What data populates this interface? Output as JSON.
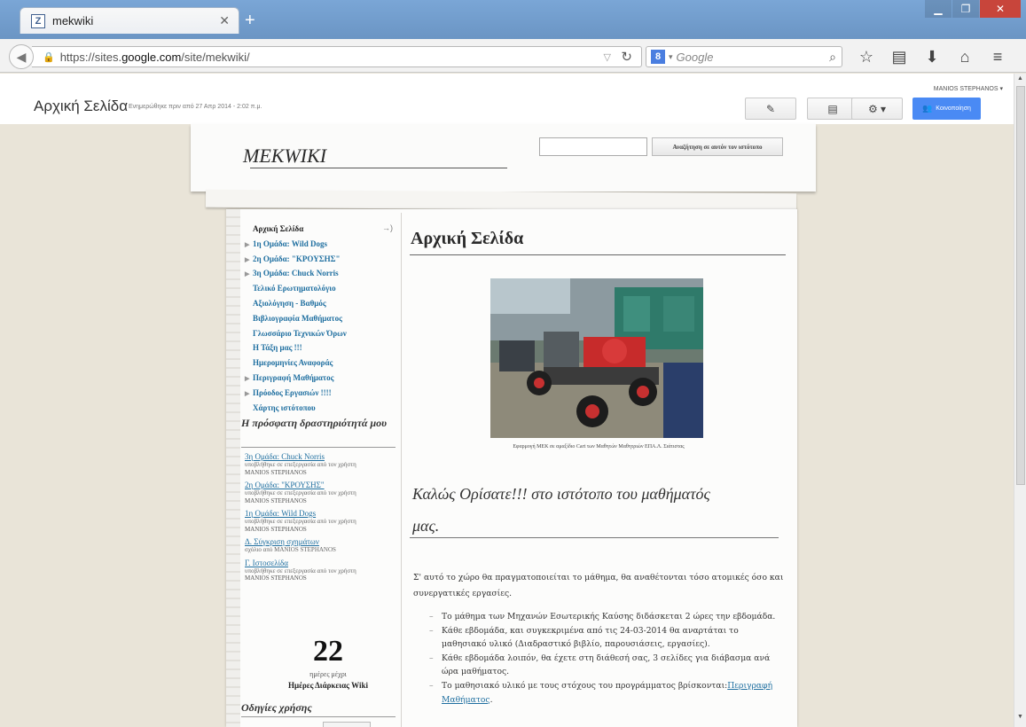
{
  "browser": {
    "tab_title": "mekwiki",
    "tab_favicon": "Z",
    "url_prefix": "https://sites.",
    "url_host": "google.com",
    "url_path": "/site/mekwiki/",
    "search_placeholder": "Google",
    "search_engine_letter": "8"
  },
  "sites_header": {
    "page_title": "Αρχική Σελίδα",
    "updated": "Ενημερώθηκε πριν από 27 Απρ 2014 - 2:02 π.μ.",
    "username": "MANIOS STEPHANOS",
    "share_label": "Κοινοποίηση",
    "accent_color": "#4a8af4"
  },
  "site": {
    "title": "MEKWIKI",
    "search_button": "Αναζήτηση σε αυτόν τον ιστότοπο"
  },
  "nav": {
    "items": [
      {
        "label": "Αρχική Σελίδα"
      },
      {
        "label": "1η Ομάδα: Wild Dogs"
      },
      {
        "label": "2η Ομάδα: \"ΚΡΟΥΣΗΣ\""
      },
      {
        "label": "3η Ομάδα: Chuck Norris"
      },
      {
        "label": "Τελικό Ερωτηματολόγιο"
      },
      {
        "label": "Αξιολόγηση - Βαθμός"
      },
      {
        "label": "Βιβλιογραφία Μαθήματος"
      },
      {
        "label": "Γλωσσάριο Τεχνικών Όρων"
      },
      {
        "label": "Η Τάξη μας !!!"
      },
      {
        "label": "Ημερομηνίες Αναφοράς"
      },
      {
        "label": "Περιγραφή Μαθήματος"
      },
      {
        "label": "Πρόοδος Εργασιών !!!!"
      },
      {
        "label": "Χάρτης ιστότοπου"
      }
    ]
  },
  "recent": {
    "title": "Η πρόσφατη δραστηριότητά μου",
    "entries": [
      {
        "link": "3η Ομάδα: Chuck Norris",
        "action": "υποβλήθηκε σε επεξεργασία από τον χρήστη",
        "user": "MANIOS STEPHANOS"
      },
      {
        "link": "2η Ομάδα: \"ΚΡΟΥΣΗΣ\"",
        "action": "υποβλήθηκε σε επεξεργασία από τον χρήστη",
        "user": "MANIOS STEPHANOS"
      },
      {
        "link": "1η Ομάδα: Wild Dogs",
        "action": "υποβλήθηκε σε επεξεργασία από τον χρήστη",
        "user": "MANIOS STEPHANOS"
      },
      {
        "link": "Δ. Σύγκριση σχημάτων",
        "action": "σχόλιο από MANIOS STEPHANOS",
        "user": ""
      },
      {
        "link": "Γ. Ιστοσελίδα",
        "action": "υποβλήθηκε σε επεξεργασία από τον χρήστη",
        "user": "MANIOS STEPHANOS"
      }
    ]
  },
  "countdown": {
    "number": "22",
    "sub": "ημέρες μέχρι",
    "label": "Ημέρες Διάρκειας Wiki"
  },
  "guide": {
    "title": "Οδηγίες χρήσης"
  },
  "main": {
    "title": "Αρχική Σελίδα",
    "caption": "Εφαρμογή ΜΕΚ σε αμαξίδιο Cart των Μαθητών Μαθητριών ΕΠΑ.Λ. Σιάτιστας",
    "welcome_line1": "Καλώς Ορίσατε!!!  στο ιστότοπο του μαθήματός",
    "welcome_line2": "μας.",
    "intro": "Σ' αυτό το χώρο θα πραγματοποιείται το μάθημα, θα αναθέτονται τόσο ατομικές όσο και συνεργατικές εργασίες.",
    "bullets": [
      "Το μάθημα των Μηχανών Εσωτερικής Καύσης διδάσκεται 2 ώρες την εβδομάδα.",
      "Κάθε εβδομάδα, και συγκεκριμένα από τις 24-03-2014 θα αναρτάται το μαθησιακό υλικό (Διαδραστικό βιβλίο, παρουσιάσεις, εργασίες).",
      "Κάθε εβδομάδα λοιπόν, θα έχετε στη διάθεσή σας, 3 σελίδες για διάβασμα ανά ώρα μαθήματος."
    ],
    "last_bullet_text": "Το μαθησιακό υλικό με τους στόχους του προγράμματος βρίσκονται:",
    "last_bullet_link": "Περιγραφή Μαθήματος",
    "last_bullet_end": "."
  }
}
